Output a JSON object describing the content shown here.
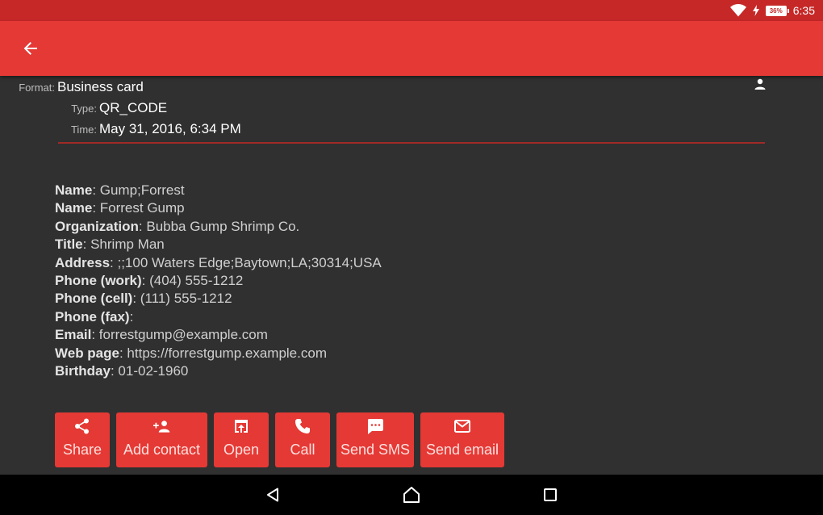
{
  "status_bar": {
    "battery": "36%",
    "time": "6:35"
  },
  "record": {
    "format_label": "Format:",
    "format_value": "Business card",
    "type_label": "Type:",
    "type_value": "QR_CODE",
    "time_label": "Time:",
    "time_value": "May 31, 2016, 6:34 PM"
  },
  "details": [
    {
      "key": "Name",
      "value": ": Gump;Forrest"
    },
    {
      "key": "Name",
      "value": ": Forrest Gump"
    },
    {
      "key": "Organization",
      "value": ": Bubba Gump Shrimp Co."
    },
    {
      "key": "Title",
      "value": ": Shrimp Man"
    },
    {
      "key": "Address",
      "value": ": ;;100 Waters Edge;Baytown;LA;30314;USA"
    },
    {
      "key": "Phone (work)",
      "value": ": (404) 555-1212"
    },
    {
      "key": "Phone (cell)",
      "value": ": (111) 555-1212"
    },
    {
      "key": "Phone (fax)",
      "value": ":"
    },
    {
      "key": "Email",
      "value": ": forrestgump@example.com"
    },
    {
      "key": "Web page",
      "value": ": https://forrestgump.example.com"
    },
    {
      "key": "Birthday",
      "value": ": 01-02-1960"
    }
  ],
  "actions": [
    {
      "label": "Share",
      "icon": "share-icon"
    },
    {
      "label": "Add contact",
      "icon": "add-person-icon"
    },
    {
      "label": "Open",
      "icon": "open-in-browser-icon"
    },
    {
      "label": "Call",
      "icon": "phone-icon"
    },
    {
      "label": "Send SMS",
      "icon": "sms-icon"
    },
    {
      "label": "Send email",
      "icon": "email-icon"
    }
  ],
  "colors": {
    "status_bar": "#c62828",
    "app_bar": "#e53935",
    "background": "#303030",
    "accent_divider": "#a02a26",
    "nav_bar": "#000000"
  }
}
